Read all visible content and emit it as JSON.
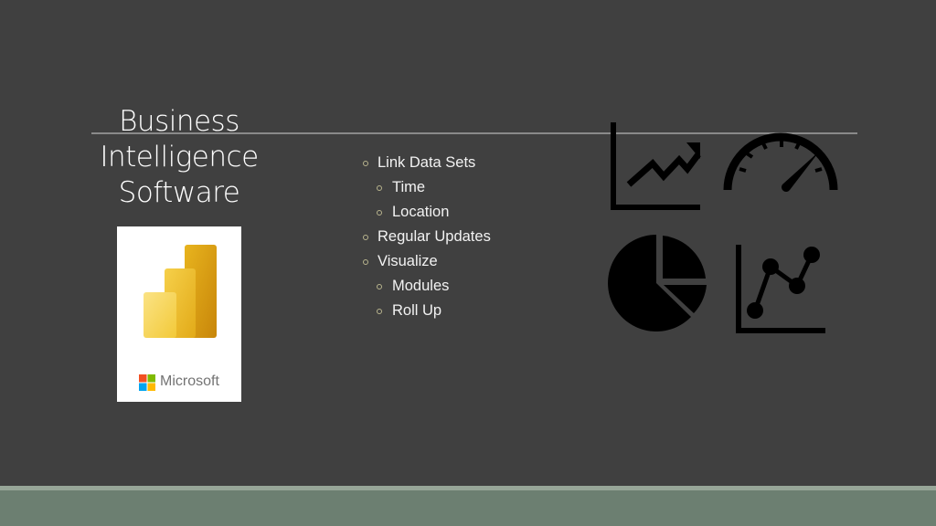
{
  "slide": {
    "title_lines": [
      "Business",
      "Intelligence",
      "Software"
    ],
    "bullets": [
      {
        "level": 1,
        "text": "Link Data Sets"
      },
      {
        "level": 2,
        "text": "Time"
      },
      {
        "level": 2,
        "text": "Location"
      },
      {
        "level": 1,
        "text": "Regular Updates"
      },
      {
        "level": 1,
        "text": "Visualize"
      },
      {
        "level": 2,
        "text": "Modules"
      },
      {
        "level": 2,
        "text": "Roll Up"
      }
    ],
    "logo": {
      "product_icon": "power-bi-icon",
      "brand_text": "Microsoft",
      "brand_colors": [
        "#f25022",
        "#7fba00",
        "#00a4ef",
        "#ffb900"
      ]
    },
    "icons": [
      "trending-up-chart-icon",
      "speedometer-gauge-icon",
      "pie-chart-icon",
      "line-chart-points-icon"
    ],
    "colors": {
      "background": "#404040",
      "bottom_band": "#6c7f71",
      "bottom_stripe": "#97a698",
      "bullet_marker": "#b9b58e"
    }
  }
}
